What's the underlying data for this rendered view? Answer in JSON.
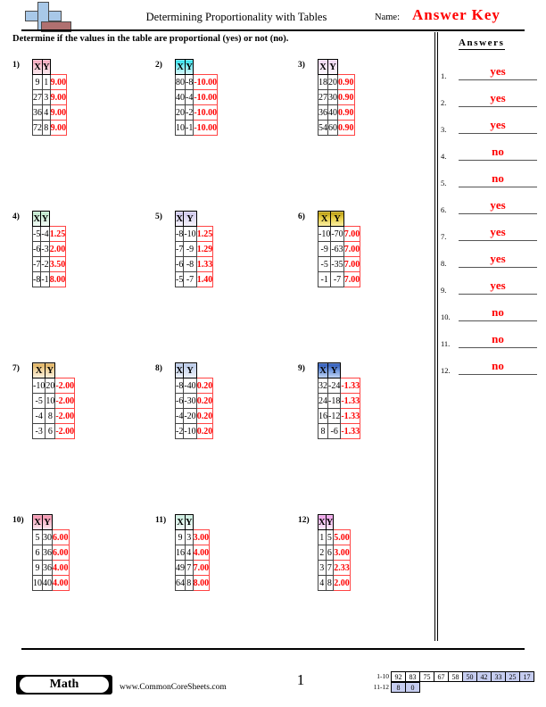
{
  "header": {
    "title": "Determining Proportionality with Tables",
    "name_label": "Name:",
    "name_value": "Answer Key",
    "instructions": "Determine if the values in the table are proportional (yes) or not (no)."
  },
  "answers_panel": {
    "heading": "Answers",
    "items": [
      {
        "num": "1.",
        "value": "yes"
      },
      {
        "num": "2.",
        "value": "yes"
      },
      {
        "num": "3.",
        "value": "yes"
      },
      {
        "num": "4.",
        "value": "no"
      },
      {
        "num": "5.",
        "value": "no"
      },
      {
        "num": "6.",
        "value": "yes"
      },
      {
        "num": "7.",
        "value": "yes"
      },
      {
        "num": "8.",
        "value": "yes"
      },
      {
        "num": "9.",
        "value": "yes"
      },
      {
        "num": "10.",
        "value": "no"
      },
      {
        "num": "11.",
        "value": "no"
      },
      {
        "num": "12.",
        "value": "no"
      }
    ]
  },
  "column_headers": {
    "x": "X",
    "y": "Y"
  },
  "questions": [
    {
      "num": "1)",
      "header_color": "#f8a8bc",
      "rows": [
        {
          "x": "9",
          "y": "1",
          "ratio": "9.00"
        },
        {
          "x": "27",
          "y": "3",
          "ratio": "9.00"
        },
        {
          "x": "36",
          "y": "4",
          "ratio": "9.00"
        },
        {
          "x": "72",
          "y": "8",
          "ratio": "9.00"
        }
      ]
    },
    {
      "num": "2)",
      "header_color": "#2fe0ec",
      "rows": [
        {
          "x": "80",
          "y": "-8",
          "ratio": "-10.00"
        },
        {
          "x": "40",
          "y": "-4",
          "ratio": "-10.00"
        },
        {
          "x": "20",
          "y": "-2",
          "ratio": "-10.00"
        },
        {
          "x": "10",
          "y": "-1",
          "ratio": "-10.00"
        }
      ]
    },
    {
      "num": "3)",
      "header_color": "#f2d8f4",
      "rows": [
        {
          "x": "18",
          "y": "20",
          "ratio": "0.90"
        },
        {
          "x": "27",
          "y": "30",
          "ratio": "0.90"
        },
        {
          "x": "36",
          "y": "40",
          "ratio": "0.90"
        },
        {
          "x": "54",
          "y": "60",
          "ratio": "0.90"
        }
      ]
    },
    {
      "num": "4)",
      "header_color": "#bfe8cc",
      "rows": [
        {
          "x": "-5",
          "y": "-4",
          "ratio": "1.25"
        },
        {
          "x": "-6",
          "y": "-3",
          "ratio": "2.00"
        },
        {
          "x": "-7",
          "y": "-2",
          "ratio": "3.50"
        },
        {
          "x": "-8",
          "y": "-1",
          "ratio": "8.00"
        }
      ]
    },
    {
      "num": "5)",
      "header_color": "#cfc8ee",
      "rows": [
        {
          "x": "-8",
          "y": "-10",
          "ratio": "1.25"
        },
        {
          "x": "-7",
          "y": "-9",
          "ratio": "1.29"
        },
        {
          "x": "-6",
          "y": "-8",
          "ratio": "1.33"
        },
        {
          "x": "-5",
          "y": "-7",
          "ratio": "1.40"
        }
      ]
    },
    {
      "num": "6)",
      "header_color": "#d4b81a",
      "rows": [
        {
          "x": "-10",
          "y": "-70",
          "ratio": "7.00"
        },
        {
          "x": "-9",
          "y": "-63",
          "ratio": "7.00"
        },
        {
          "x": "-5",
          "y": "-35",
          "ratio": "7.00"
        },
        {
          "x": "-1",
          "y": "-7",
          "ratio": "7.00"
        }
      ]
    },
    {
      "num": "7)",
      "header_color": "#e8c27a",
      "rows": [
        {
          "x": "-10",
          "y": "20",
          "ratio": "-2.00"
        },
        {
          "x": "-5",
          "y": "10",
          "ratio": "-2.00"
        },
        {
          "x": "-4",
          "y": "8",
          "ratio": "-2.00"
        },
        {
          "x": "-3",
          "y": "6",
          "ratio": "-2.00"
        }
      ]
    },
    {
      "num": "8)",
      "header_color": "#b8c8e8",
      "rows": [
        {
          "x": "-8",
          "y": "-40",
          "ratio": "0.20"
        },
        {
          "x": "-6",
          "y": "-30",
          "ratio": "0.20"
        },
        {
          "x": "-4",
          "y": "-20",
          "ratio": "0.20"
        },
        {
          "x": "-2",
          "y": "-10",
          "ratio": "0.20"
        }
      ]
    },
    {
      "num": "9)",
      "header_color": "#2a56b8",
      "rows": [
        {
          "x": "32",
          "y": "-24",
          "ratio": "-1.33"
        },
        {
          "x": "24",
          "y": "-18",
          "ratio": "-1.33"
        },
        {
          "x": "16",
          "y": "-12",
          "ratio": "-1.33"
        },
        {
          "x": "8",
          "y": "-6",
          "ratio": "-1.33"
        }
      ]
    },
    {
      "num": "10)",
      "header_color": "#f592ad",
      "rows": [
        {
          "x": "5",
          "y": "30",
          "ratio": "6.00"
        },
        {
          "x": "6",
          "y": "36",
          "ratio": "6.00"
        },
        {
          "x": "9",
          "y": "36",
          "ratio": "4.00"
        },
        {
          "x": "10",
          "y": "40",
          "ratio": "4.00"
        }
      ]
    },
    {
      "num": "11)",
      "header_color": "#cbeee0",
      "rows": [
        {
          "x": "9",
          "y": "3",
          "ratio": "3.00"
        },
        {
          "x": "16",
          "y": "4",
          "ratio": "4.00"
        },
        {
          "x": "49",
          "y": "7",
          "ratio": "7.00"
        },
        {
          "x": "64",
          "y": "8",
          "ratio": "8.00"
        }
      ]
    },
    {
      "num": "12)",
      "header_color": "#f0a0ea",
      "rows": [
        {
          "x": "1",
          "y": "5",
          "ratio": "5.00"
        },
        {
          "x": "2",
          "y": "6",
          "ratio": "3.00"
        },
        {
          "x": "3",
          "y": "7",
          "ratio": "2.33"
        },
        {
          "x": "4",
          "y": "8",
          "ratio": "2.00"
        }
      ]
    }
  ],
  "footer": {
    "subject_badge": "Math",
    "site_url": "www.CommonCoreSheets.com",
    "page_number": "1",
    "score_grid": {
      "row1_label": "1-10",
      "row1_values": [
        "92",
        "83",
        "75",
        "67",
        "58",
        "50",
        "42",
        "33",
        "25",
        "17"
      ],
      "row1_shaded": [
        false,
        false,
        false,
        false,
        false,
        true,
        true,
        true,
        true,
        true
      ],
      "row2_label": "11-12",
      "row2_values": [
        "8",
        "0"
      ],
      "row2_shaded": [
        true,
        true
      ]
    }
  }
}
